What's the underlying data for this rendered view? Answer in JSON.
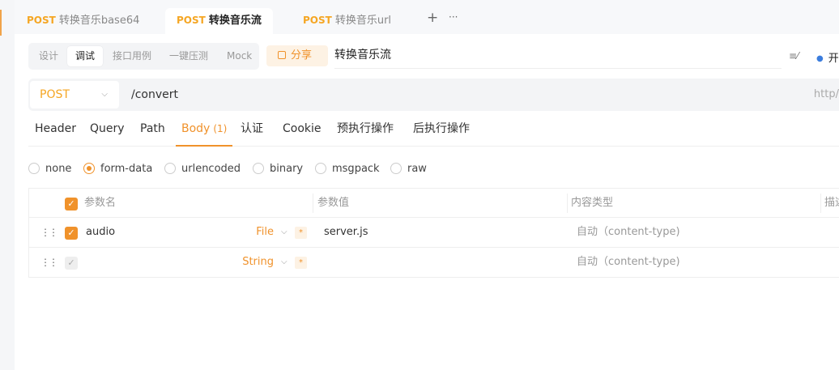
{
  "tabs": [
    {
      "method": "POST",
      "label": "转换音乐base64"
    },
    {
      "method": "POST",
      "label": "转换音乐流"
    },
    {
      "method": "POST",
      "label": "转换音乐url"
    }
  ],
  "tab_actions": {
    "add": "+",
    "more": "···"
  },
  "modes": [
    "设计",
    "调试",
    "接口用例",
    "一键压测",
    "Mock"
  ],
  "share_label": "分享",
  "api_name": "转换音乐流",
  "open_label": "开",
  "request": {
    "method": "POST",
    "path": "/convert",
    "base_url": "http/"
  },
  "req_tabs": {
    "header": "Header",
    "query": "Query",
    "path": "Path",
    "body": "Body",
    "body_count": "(1)",
    "auth": "认证",
    "cookie": "Cookie",
    "pre": "预执行操作",
    "post": "后执行操作"
  },
  "body_types": {
    "none": "none",
    "form_data": "form-data",
    "urlencoded": "urlencoded",
    "binary": "binary",
    "msgpack": "msgpack",
    "raw": "raw"
  },
  "selected_body_type": "form-data",
  "table": {
    "headers": {
      "name": "参数名",
      "value": "参数值",
      "content_type": "内容类型",
      "desc": "描述"
    },
    "rows": [
      {
        "checked": true,
        "name": "audio",
        "type": "File",
        "value": "server.js",
        "content_type": "自动（content-type)"
      },
      {
        "checked": true,
        "name": "",
        "type": "String",
        "value": "",
        "content_type": "自动（content-type)"
      }
    ]
  },
  "colors": {
    "accent": "#f0922b",
    "method": "#f5a623",
    "link_dot": "#3b7ddd"
  }
}
